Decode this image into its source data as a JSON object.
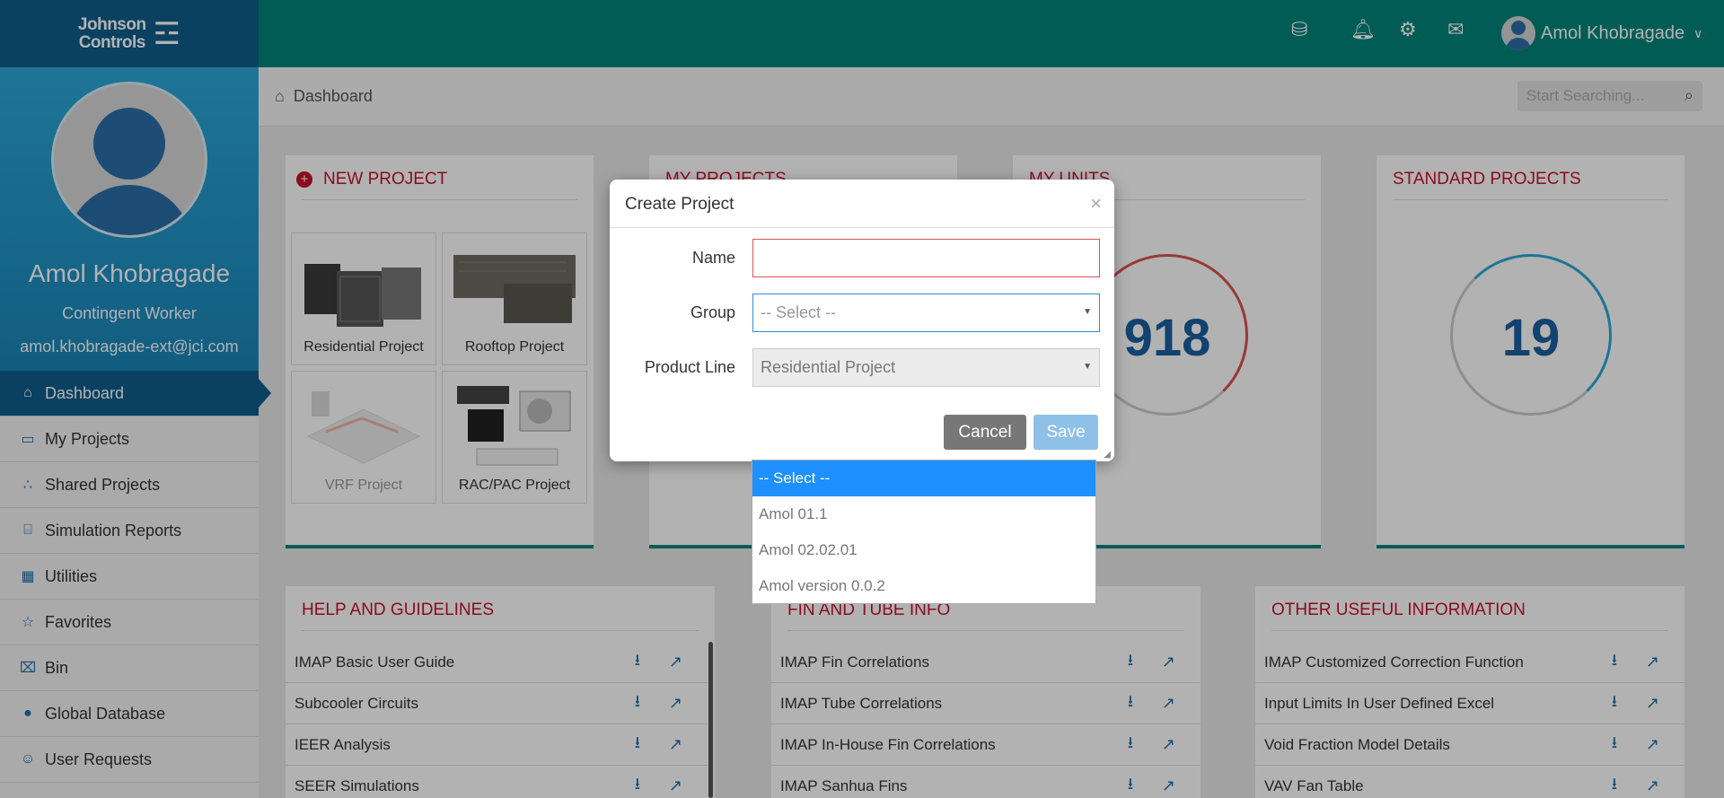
{
  "brand": {
    "logo_line1": "Johnson",
    "logo_line2": "Controls"
  },
  "profile": {
    "name": "Amol Khobragade",
    "role": "Contingent Worker",
    "email": "amol.khobragade-ext@jci.com"
  },
  "nav": [
    {
      "label": "Dashboard",
      "icon": "home-icon",
      "active": true
    },
    {
      "label": "My Projects",
      "icon": "monitor-icon"
    },
    {
      "label": "Shared Projects",
      "icon": "share-icon"
    },
    {
      "label": "Simulation Reports",
      "icon": "code-file-icon"
    },
    {
      "label": "Utilities",
      "icon": "grid-icon"
    },
    {
      "label": "Favorites",
      "icon": "star-icon"
    },
    {
      "label": "Bin",
      "icon": "trash-icon"
    },
    {
      "label": "Global Database",
      "icon": "globe-icon"
    },
    {
      "label": "User Requests",
      "icon": "user-icon"
    }
  ],
  "topbar": {
    "user_name": "Amol Khobragade"
  },
  "breadcrumb": {
    "label": "Dashboard"
  },
  "search": {
    "placeholder": "Start Searching..."
  },
  "cards": {
    "new_project": {
      "title": "NEW PROJECT",
      "tiles": [
        "Residential Project",
        "Rooftop Project",
        "VRF Project",
        "RAC/PAC Project"
      ]
    },
    "my_projects": {
      "title": "MY PROJECTS"
    },
    "my_units": {
      "title": "MY UNITS",
      "count": "918"
    },
    "standard_projects": {
      "title": "STANDARD PROJECTS",
      "count": "19"
    }
  },
  "help": {
    "title": "HELP AND GUIDELINES",
    "rows": [
      "IMAP Basic User Guide",
      "Subcooler Circuits",
      "IEER Analysis",
      "SEER Simulations"
    ]
  },
  "fin_tube": {
    "title": "FIN AND TUBE INFO",
    "rows": [
      "IMAP Fin Correlations",
      "IMAP Tube Correlations",
      "IMAP In-House Fin Correlations",
      "IMAP Sanhua Fins"
    ]
  },
  "other_info": {
    "title": "OTHER USEFUL INFORMATION",
    "rows": [
      "IMAP Customized Correction Function",
      "Input Limits In User Defined Excel",
      "Void Fraction Model Details",
      "VAV Fan Table"
    ]
  },
  "modal": {
    "title": "Create Project",
    "close": "×",
    "name_label": "Name",
    "name_value": "",
    "group_label": "Group",
    "group_value": "-- Select --",
    "product_label": "Product Line",
    "product_value": "Residential Project",
    "cancel": "Cancel",
    "save": "Save"
  },
  "dropdown": {
    "options": [
      "-- Select --",
      "Amol 01.1",
      "Amol 02.02.01",
      "Amol version 0.0.2"
    ],
    "selected_index": 0
  },
  "colors": {
    "header": "#00857a",
    "sidebar_active": "#0f5e8c",
    "card_title": "#c8102e",
    "accent_blue": "#1e90ff"
  }
}
